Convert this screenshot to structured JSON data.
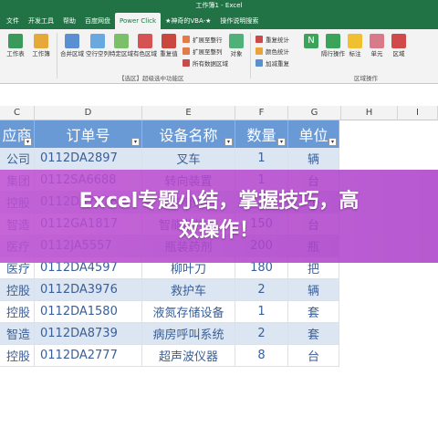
{
  "window": {
    "title": "工作簿1 - Excel"
  },
  "tabs": [
    "文件",
    "开发工具",
    "帮助",
    "百度网盘",
    "Power Click",
    "★神奇的VBA-★",
    "操作说明搜索"
  ],
  "ribbon": {
    "buttons": [
      "工作表",
      "工作簿",
      "合并区域",
      "空行空列",
      "特定区域",
      "有色区域",
      "重复值",
      "扩展至整行",
      "扩展至整列",
      "所有数据区域",
      "对象",
      "重复统计",
      "颜色统计",
      "加减重复",
      "N",
      "隔行操作",
      "标注",
      "单元",
      "区域"
    ],
    "group_labels": [
      "【选区】超级选中功能区",
      "区域操作"
    ]
  },
  "columns": {
    "letters": [
      "C",
      "D",
      "E",
      "F",
      "G",
      "H",
      "I"
    ]
  },
  "table": {
    "headers": [
      "应商",
      "订单号",
      "设备名称",
      "数量",
      "单位"
    ],
    "rows": [
      [
        "公司",
        "0112DA2897",
        "叉车",
        "1",
        "辆"
      ],
      [
        "集团",
        "0112SA6688",
        "转向装置",
        "1",
        "台"
      ],
      [
        "控股",
        "0112DA7778",
        "精密仪表",
        "3",
        "个"
      ],
      [
        "智造",
        "0112GA1817",
        "智能监控器",
        "150",
        "台"
      ],
      [
        "医疗",
        "0112JA5557",
        "瓶装药剂",
        "200",
        "瓶"
      ],
      [
        "医疗",
        "0112DA4597",
        "柳叶刀",
        "180",
        "把"
      ],
      [
        "控股",
        "0112DA3976",
        "救护车",
        "2",
        "辆"
      ],
      [
        "控股",
        "0112DA1580",
        "液氮存储设备",
        "1",
        "套"
      ],
      [
        "智造",
        "0112DA8739",
        "病房呼叫系统",
        "2",
        "套"
      ],
      [
        "控股",
        "0112DA2777",
        "超声波仪器",
        "8",
        "台"
      ]
    ]
  },
  "banner": {
    "line1": "Excel专题小结，掌握技巧，高",
    "line2": "效操作！"
  },
  "colors": {
    "excel_green": "#217346",
    "table_header": "#6a9ad6",
    "banner": "#c050d2"
  }
}
